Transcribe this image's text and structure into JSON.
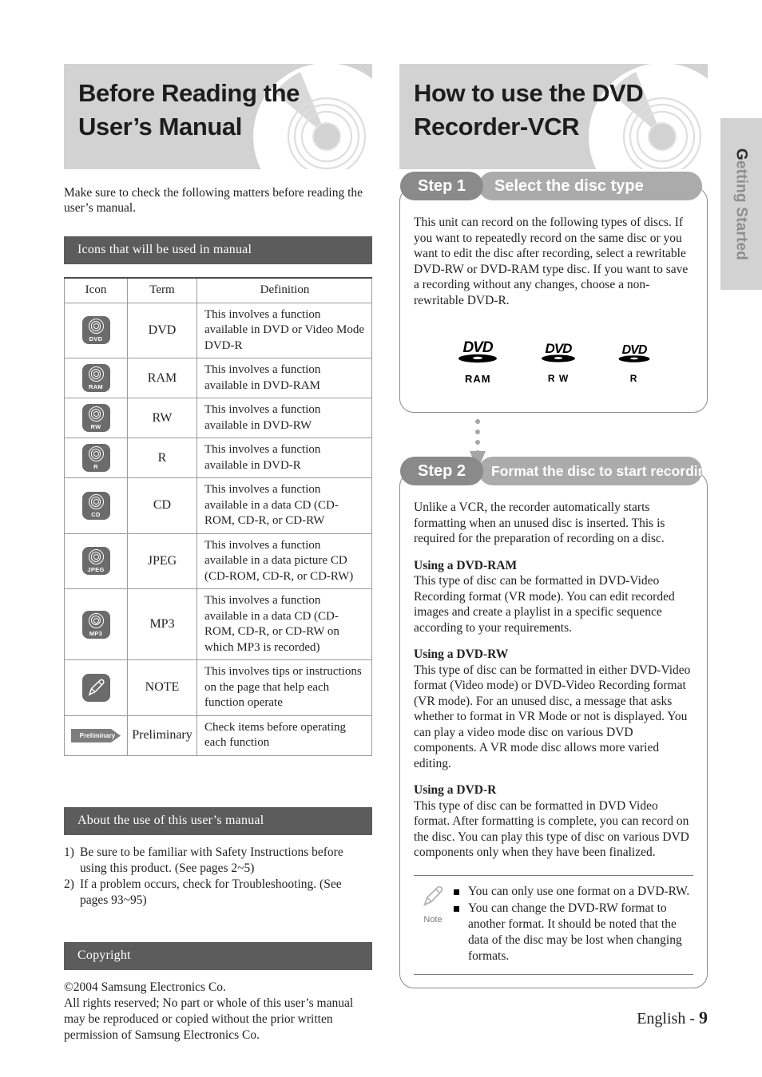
{
  "side_tab": {
    "label": "Getting Started",
    "first_char": "G",
    "rest": "etting Started"
  },
  "left": {
    "banner_title_lines": [
      "Before Reading the",
      "User’s Manual"
    ],
    "intro": "Make sure to check the following matters before reading the user’s manual.",
    "icons_section": {
      "heading": "Icons that will be used in manual",
      "columns": [
        "Icon",
        "Term",
        "Definition"
      ],
      "rows": [
        {
          "icon": "dvd-disc-icon",
          "icon_label": "DVD",
          "term": "DVD",
          "definition": "This involves a function available in DVD or Video Mode DVD-R"
        },
        {
          "icon": "ram-disc-icon",
          "icon_label": "RAM",
          "term": "RAM",
          "definition": "This involves a function available in DVD-RAM"
        },
        {
          "icon": "rw-disc-icon",
          "icon_label": "RW",
          "term": "RW",
          "definition": "This involves a function available in DVD-RW"
        },
        {
          "icon": "r-disc-icon",
          "icon_label": "R",
          "term": "R",
          "definition": "This involves a function available in DVD-R"
        },
        {
          "icon": "cd-disc-icon",
          "icon_label": "CD",
          "term": "CD",
          "definition": "This involves a function available in a data CD (CD-ROM, CD-R, or CD-RW"
        },
        {
          "icon": "jpeg-disc-icon",
          "icon_label": "JPEG",
          "term": "JPEG",
          "definition": "This involves a function available in a data picture CD (CD-ROM, CD-R, or CD-RW)"
        },
        {
          "icon": "mp3-disc-icon",
          "icon_label": "MP3",
          "term": "MP3",
          "definition": "This involves a function available in a data CD (CD-ROM, CD-R, or CD-RW on which MP3 is recorded)"
        },
        {
          "icon": "note-pencil-icon",
          "icon_label": "",
          "term": "NOTE",
          "definition": "This involves tips or instructions on the page that help each function operate"
        },
        {
          "icon": "preliminary-flag-icon",
          "icon_label": "Preliminary",
          "term": "Preliminary",
          "definition": "Check items before operating each function"
        }
      ]
    },
    "about_section": {
      "heading": "About the use of this user’s manual",
      "items": [
        {
          "num": "1)",
          "text": "Be sure to be familiar with Safety Instructions before using this product. (See pages 2~5)"
        },
        {
          "num": "2)",
          "text": "If a problem occurs, check for Troubleshooting. (See pages 93~95)"
        }
      ]
    },
    "copyright_section": {
      "heading": "Copyright",
      "lines": [
        "©2004 Samsung Electronics Co.",
        "All rights reserved; No part or whole of this user’s manual may be reproduced or copied without the prior written permission of Samsung Electronics Co."
      ]
    }
  },
  "right": {
    "banner_title_lines": [
      "How to use the DVD",
      "Recorder-VCR"
    ],
    "step1": {
      "num_label": "Step 1",
      "title": "Select the disc type",
      "body": "This unit can record on the following types of discs. If you want to repeatedly record on the same disc or you want to edit the disc after recording, select a rewritable DVD-RW or DVD-RAM type disc. If you want to save a recording without any changes, choose a non-rewritable DVD-R.",
      "disc_logos": [
        {
          "logo": "DVD",
          "caption": "RAM"
        },
        {
          "logo": "DVD",
          "caption": "R W"
        },
        {
          "logo": "DVD",
          "caption": "R"
        }
      ]
    },
    "step2": {
      "num_label": "Step 2",
      "title": "Format the disc to start recording",
      "intro": "Unlike a VCR, the recorder automatically starts formatting when an unused disc is inserted. This is required for the preparation of recording on a disc.",
      "subsections": [
        {
          "heading": "Using a DVD-RAM",
          "text": "This type of disc can be formatted in DVD-Video Recording format (VR mode). You can edit recorded images and create a playlist in a specific sequence according to your requirements."
        },
        {
          "heading": "Using a DVD-RW",
          "text": "This type of disc can be formatted in either DVD-Video format (Video mode) or DVD-Video Recording format (VR mode). For an unused disc, a message that asks whether to format in VR Mode or not is displayed. You can play a video mode disc on various DVD components. A VR mode disc allows more varied editing."
        },
        {
          "heading": "Using a DVD-R",
          "text": "This type of disc can be formatted in DVD Video format. After formatting is complete, you can record on the disc. You can play this type of disc on various DVD components only when they have been finalized."
        }
      ],
      "note": {
        "label": "Note",
        "items": [
          "You can only use one format on a DVD-RW.",
          "You can change the DVD-RW format to another format. It should be noted that the data of the disc may be lost when changing formats."
        ]
      }
    }
  },
  "footer": {
    "language": "English - ",
    "page": "9"
  },
  "colors": {
    "banner_bg": "#d2d2d2",
    "section_bar_bg": "#5c5c5c",
    "step_num_bg": "#8a8a8a",
    "step_title_bg": "#ababab",
    "icon_badge_bg": "#6b6b6b",
    "connector": "#a6a6a6",
    "side_tab_bg": "#d2d2d2"
  }
}
